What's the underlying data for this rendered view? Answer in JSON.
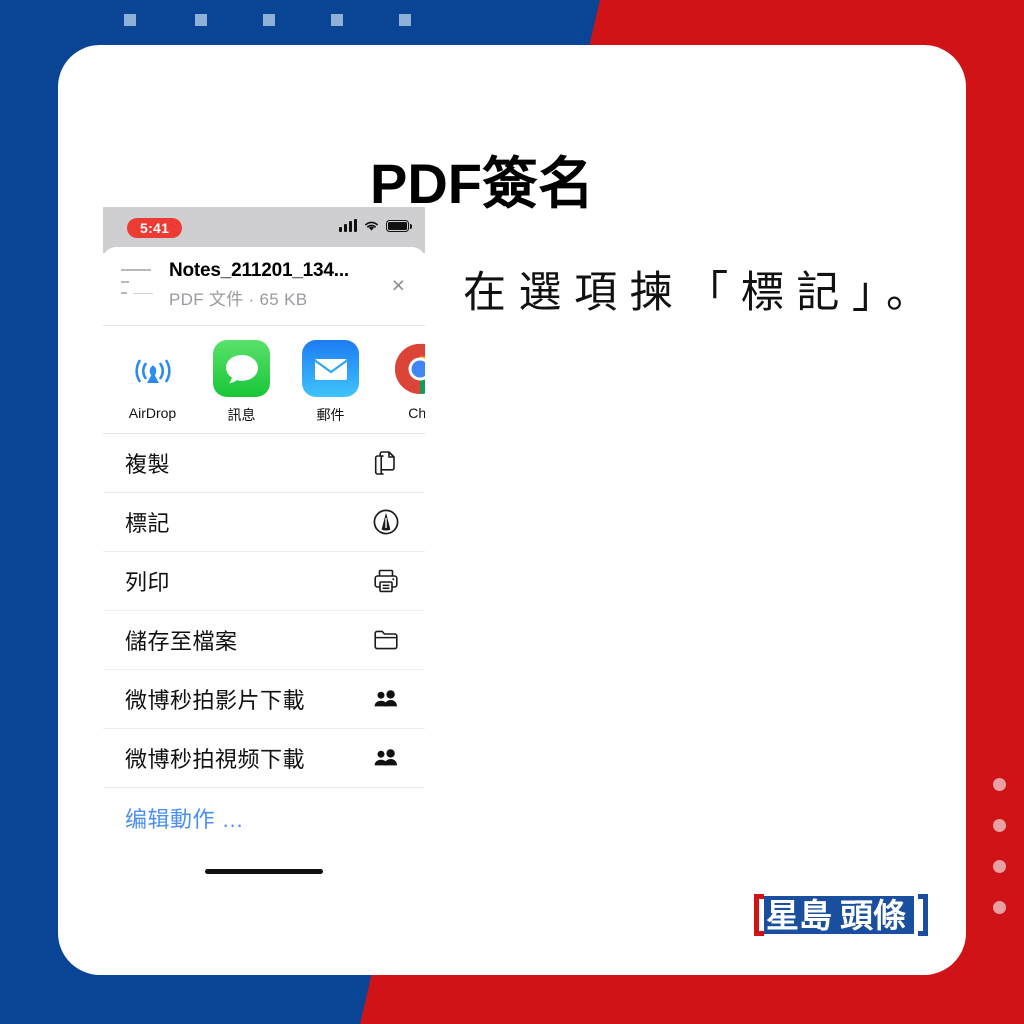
{
  "theme": {
    "blue": "#0a4595",
    "red": "#cf1316",
    "card_bg": "#ffffff",
    "accent_link": "#4b8ff0",
    "top_square": "#8fb0d6",
    "right_dot": "#e8a0a2"
  },
  "page_title": "PDF簽名",
  "instruction": "在選項揀「標記」。",
  "decor": {
    "top_squares": [
      124,
      195,
      263,
      331,
      399
    ],
    "right_dots_count": 4
  },
  "phone": {
    "statusbar": {
      "time": "5:41",
      "signal_icon": "cellular-bars-icon",
      "wifi_icon": "wifi-icon",
      "battery_icon": "battery-icon"
    },
    "file": {
      "name": "Notes_211201_134...",
      "subtitle": "PDF 文件 · 65 KB",
      "close_label": "×",
      "thumb_icon": "document-thumbnail-icon"
    },
    "apps": [
      {
        "name": "AirDrop",
        "icon": "airdrop-icon"
      },
      {
        "name": "訊息",
        "icon": "messages-icon"
      },
      {
        "name": "郵件",
        "icon": "mail-icon"
      },
      {
        "name": "Chr",
        "icon": "chrome-icon"
      }
    ],
    "actions": [
      {
        "label": "複製",
        "icon": "copy-icon",
        "link": false
      },
      {
        "label": "標記",
        "icon": "markup-icon",
        "link": false
      },
      {
        "label": "列印",
        "icon": "print-icon",
        "link": false
      },
      {
        "label": "儲存至檔案",
        "icon": "folder-icon",
        "link": false
      },
      {
        "label": "微博秒拍影片下載",
        "icon": "people-icon",
        "link": false
      },
      {
        "label": "微博秒拍視频下載",
        "icon": "people-icon",
        "link": false
      },
      {
        "label": "编辑動作 …",
        "icon": "none",
        "link": true
      }
    ]
  },
  "logo": {
    "text_left": "星島",
    "text_right": "頭條",
    "left_color": "#1a4fa0",
    "right_color": "#cf1316"
  }
}
